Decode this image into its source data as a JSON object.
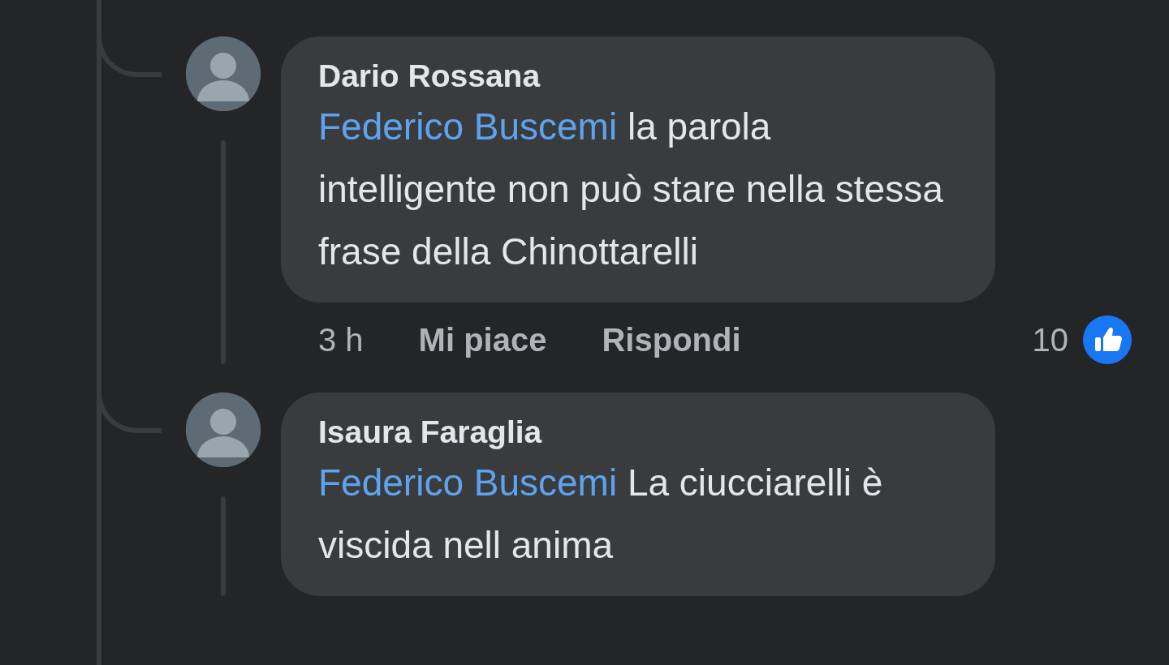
{
  "comments": [
    {
      "author": "Dario Rossana",
      "mention": "Federico Buscemi",
      "text": "la parola intelligente non può stare nella stessa frase della Chinottarelli",
      "actions": {
        "time": "3 h",
        "like": "Mi piace",
        "reply": "Rispondi",
        "reaction_count": "10"
      }
    },
    {
      "author": "Isaura Faraglia",
      "mention": "Federico Buscemi",
      "text": "La ciucciarelli è viscida nell anima"
    }
  ]
}
